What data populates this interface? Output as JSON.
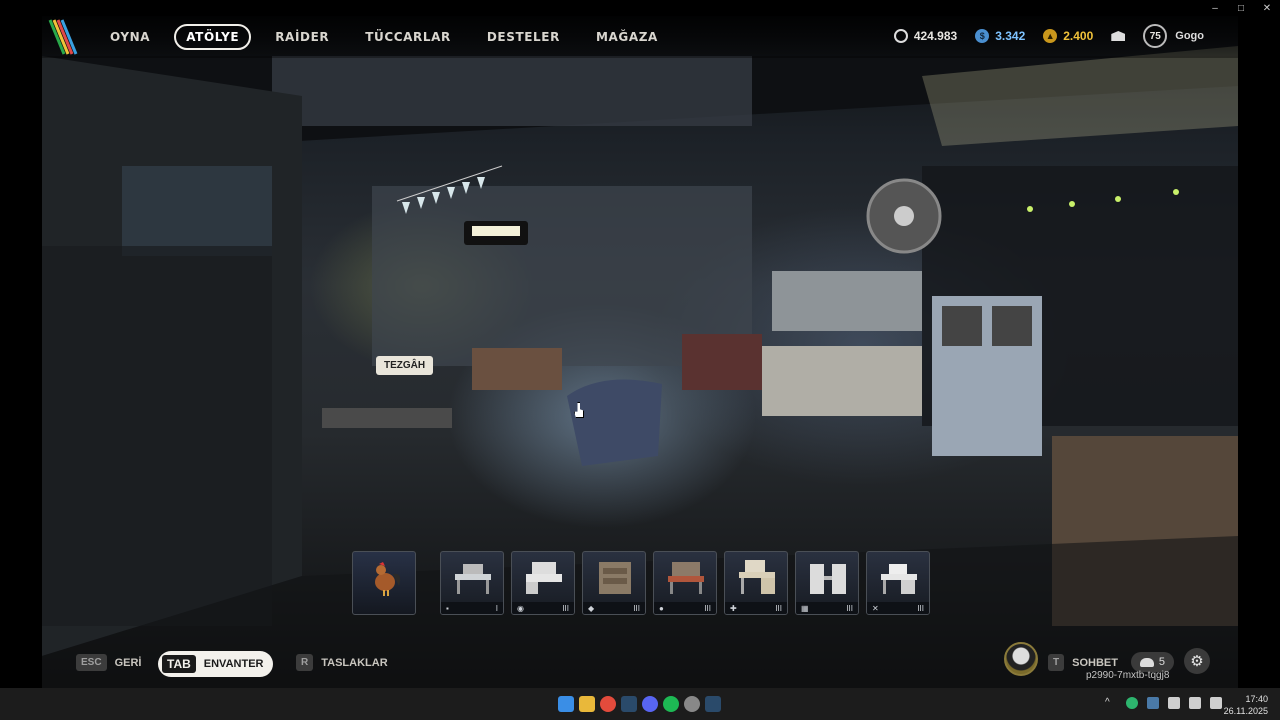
{
  "window": {
    "controls": [
      "–",
      "□",
      "✕"
    ]
  },
  "nav": {
    "items": [
      {
        "label": "OYNA",
        "active": false
      },
      {
        "label": "ATÖLYE",
        "active": true
      },
      {
        "label": "RAİDER",
        "active": false
      },
      {
        "label": "TÜCCARLAR",
        "active": false
      },
      {
        "label": "DESTELER",
        "active": false
      },
      {
        "label": "MAĞAZA",
        "active": false
      }
    ]
  },
  "currencies": {
    "coins": "424.983",
    "blue": "3.342",
    "gold": "2.400"
  },
  "player": {
    "level": "75",
    "name": "Gogo"
  },
  "scene": {
    "tooltip": "TEZGÂH"
  },
  "hotbar": {
    "slots": [
      {
        "icon": "rooster-icon"
      },
      {
        "icon": "workbench-icon",
        "badge": "▪",
        "tier": "I"
      },
      {
        "icon": "workbench-icon",
        "badge": "◉",
        "tier": "III"
      },
      {
        "icon": "workbench-icon",
        "badge": "◆",
        "tier": "III"
      },
      {
        "icon": "workbench-icon",
        "badge": "●",
        "tier": "III"
      },
      {
        "icon": "workbench-icon",
        "badge": "✚",
        "tier": "III"
      },
      {
        "icon": "workbench-icon",
        "badge": "▦",
        "tier": "III"
      },
      {
        "icon": "workbench-icon",
        "badge": "✕",
        "tier": "III"
      }
    ]
  },
  "bottom": {
    "back": {
      "key": "ESC",
      "label": "GERİ"
    },
    "inventory": {
      "key": "TAB",
      "label": "ENVANTER"
    },
    "blueprints": {
      "key": "R",
      "label": "TASLAKLAR"
    },
    "chat": {
      "key": "T",
      "label": "SOHBET"
    },
    "friends_count": "5",
    "session_id": "p2990-7mxtb-tqgj8"
  },
  "taskbar": {
    "time": "17:40",
    "date": "26.11.2025"
  },
  "colors": {
    "blue_currency": "#7ec3ff",
    "gold_currency": "#f0c23a"
  }
}
